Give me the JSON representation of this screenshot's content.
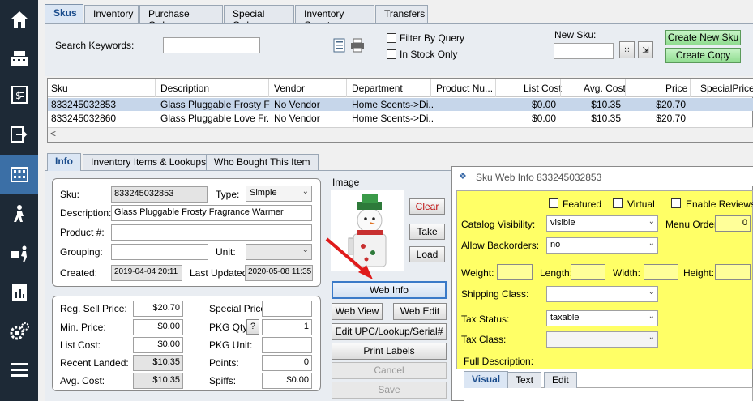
{
  "sidebar": {
    "icons": [
      "home-icon",
      "register-icon",
      "invoice-icon",
      "exit-icon",
      "inventory-icon",
      "delivery-icon",
      "shipping-icon",
      "reports-icon",
      "settings-icon",
      "menu-icon"
    ]
  },
  "tabs": [
    "Skus",
    "Inventory",
    "Purchase Orders",
    "Special Order",
    "Inventory Count",
    "Transfers"
  ],
  "search": {
    "label": "Search Keywords:",
    "value": ""
  },
  "filters": {
    "filter_by_query": "Filter By Query",
    "in_stock_only": "In Stock Only"
  },
  "new_sku": {
    "label": "New Sku:",
    "value": "",
    "create_new": "Create New Sku",
    "create_copy": "Create Copy"
  },
  "grid": {
    "columns": [
      "Sku",
      "Description",
      "Vendor",
      "Department",
      "Product Nu...",
      "List Cost",
      "Avg. Cost",
      "Price",
      "SpecialPrice"
    ],
    "rows": [
      [
        "833245032853",
        "Glass Pluggable Frosty Fr...",
        "No Vendor",
        "Home Scents->Di...",
        "",
        "$0.00",
        "$10.35",
        "$20.70",
        ""
      ],
      [
        "833245032860",
        "Glass Pluggable Love Fr...",
        "No Vendor",
        "Home Scents->Di...",
        "",
        "$0.00",
        "$10.35",
        "$20.70",
        ""
      ]
    ],
    "scroll_left": "<"
  },
  "detail_tabs": [
    "Info",
    "Inventory Items & Lookups",
    "Who Bought This Item"
  ],
  "info": {
    "sku_label": "Sku:",
    "sku": "833245032853",
    "type_label": "Type:",
    "type": "Simple",
    "desc_label": "Description:",
    "desc": "Glass Pluggable Frosty Fragrance Warmer",
    "product_label": "Product #:",
    "product": "",
    "grouping_label": "Grouping:",
    "grouping": "",
    "unit_label": "Unit:",
    "unit": "",
    "created_label": "Created:",
    "created": "2019-04-04 20:11",
    "updated_label": "Last Updated:",
    "updated": "2020-05-08 11:35"
  },
  "pricing": {
    "reg_label": "Reg. Sell Price:",
    "reg": "$20.70",
    "min_label": "Min. Price:",
    "min": "$0.00",
    "list_label": "List Cost:",
    "list": "$0.00",
    "landed_label": "Recent Landed:",
    "landed": "$10.35",
    "avg_label": "Avg. Cost:",
    "avg": "$10.35",
    "special_label": "Special Price:",
    "special": "",
    "pkgqty_label": "PKG Qty:",
    "pkgqty_help": "?",
    "pkgqty": "1",
    "pkgunit_label": "PKG Unit:",
    "pkgunit": "",
    "points_label": "Points:",
    "points": "0",
    "spiffs_label": "Spiffs:",
    "spiffs": "$0.00"
  },
  "image": {
    "label": "Image",
    "clear": "Clear",
    "take": "Take",
    "load": "Load"
  },
  "actions": {
    "web_info": "Web Info",
    "web_view": "Web View",
    "web_edit": "Web Edit",
    "edit_upc": "Edit UPC/Lookup/Serial#",
    "print_labels": "Print Labels",
    "cancel": "Cancel",
    "save": "Save"
  },
  "web_info": {
    "title": "Sku Web Info 833245032853",
    "featured": "Featured",
    "virtual": "Virtual",
    "enable_reviews": "Enable Reviews",
    "catalog_label": "Catalog Visibility:",
    "catalog": "visible",
    "menu_order_label": "Menu Order:",
    "menu_order": "0",
    "backorders_label": "Allow Backorders:",
    "backorders": "no",
    "weight_label": "Weight:",
    "length_label": "Length:",
    "width_label": "Width:",
    "height_label": "Height:",
    "shipping_label": "Shipping Class:",
    "shipping": "",
    "tax_status_label": "Tax Status:",
    "tax_status": "taxable",
    "tax_class_label": "Tax Class:",
    "tax_class": "",
    "full_desc_label": "Full Description:",
    "editor_tabs": [
      "Visual",
      "Text",
      "Edit"
    ]
  },
  "colors": {
    "sidebar": "#1d2936",
    "accent": "#3b6fa6",
    "selected_row": "#c6d6ea",
    "panel_yellow": "#ffff66",
    "arrow": "#e01b1b",
    "create_green": "#9be29b"
  }
}
